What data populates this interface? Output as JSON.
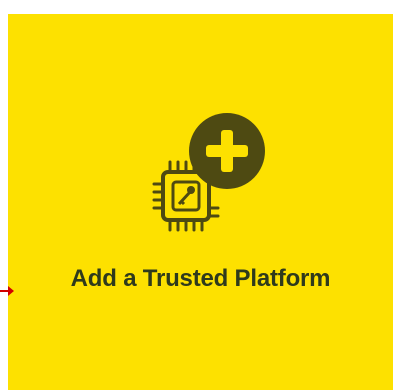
{
  "tile": {
    "label": "Add a Trusted Platform",
    "background_color": "#fde100",
    "icon_color": "#4e4a12"
  },
  "icons": {
    "primary": "chip-key-icon",
    "badge": "plus-circle-icon",
    "pointer": "arrow-pointer-icon"
  }
}
